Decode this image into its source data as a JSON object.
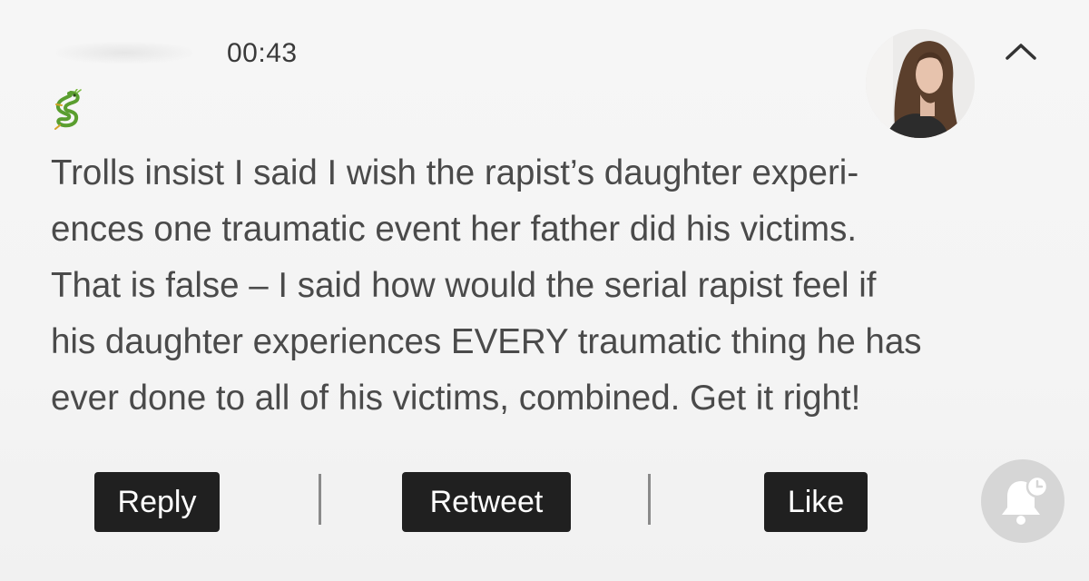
{
  "header": {
    "timestamp": "00:43"
  },
  "icons": {
    "author_emoji": "dragon-icon",
    "avatar": "avatar",
    "collapse": "chevron-up-icon",
    "notification": "bell-clock-icon"
  },
  "tweet": {
    "lines": [
      "Trolls insist I said I wish the rapist’s daughter experi-",
      "ences one traumatic event her father did his victims.",
      "That is false – I said how would the serial rapist feel if",
      "his daughter experiences EVERY traumatic thing he has",
      "ever done to all of his victims, combined. Get it right!"
    ]
  },
  "actions": {
    "reply_label": "Reply",
    "retweet_label": "Retweet",
    "like_label": "Like"
  },
  "colors": {
    "background": "#f3f3f3",
    "text": "#4a4a4a",
    "button_bg": "#202020",
    "button_text": "#ffffff",
    "bell_bg": "#d6d6d6"
  }
}
